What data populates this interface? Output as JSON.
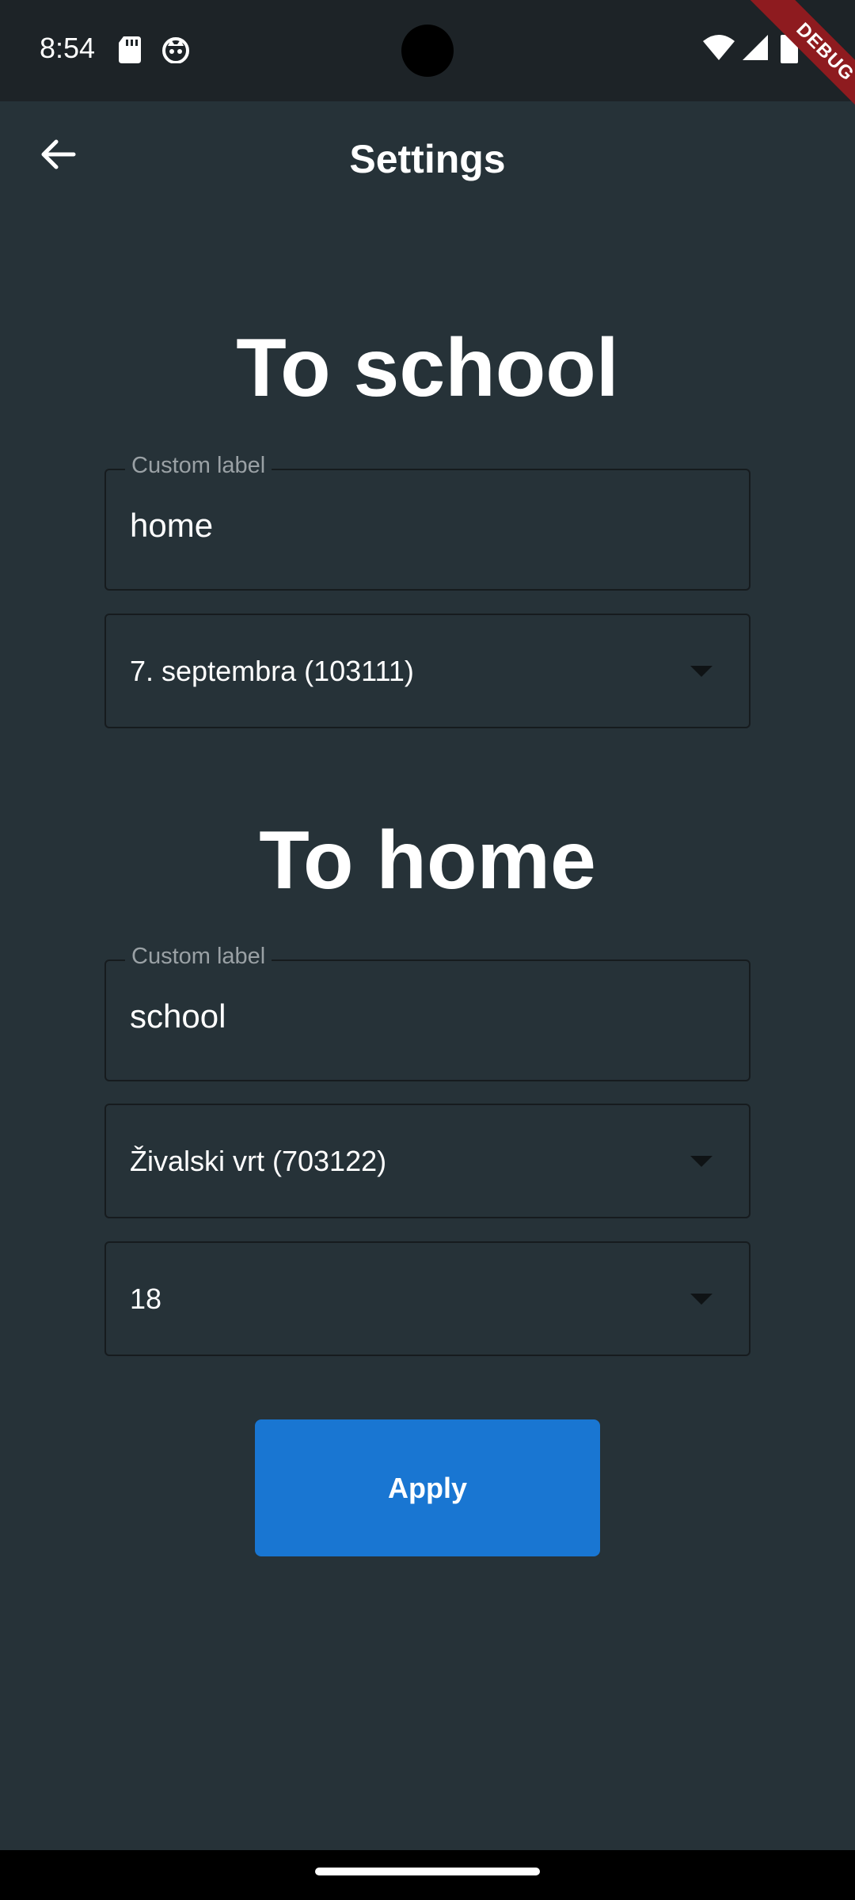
{
  "status_bar": {
    "time": "8:54",
    "icons": [
      "sd-card-icon",
      "cat-icon",
      "wifi-icon",
      "signal-icon",
      "battery-icon"
    ]
  },
  "debug_banner": {
    "label": "DEBUG"
  },
  "app_bar": {
    "title": "Settings",
    "back_icon": "arrow-back-icon"
  },
  "to_school": {
    "title": "To school",
    "custom_label": {
      "label": "Custom label",
      "value": "home"
    },
    "station": {
      "value": "7. septembra (103111)"
    }
  },
  "to_home": {
    "title": "To home",
    "custom_label": {
      "label": "Custom label",
      "value": "school"
    },
    "station": {
      "value": "Živalski vrt (703122)"
    },
    "line": {
      "value": "18"
    }
  },
  "apply_button": {
    "label": "Apply"
  },
  "colors": {
    "background": "#263238",
    "accent": "#1976d2",
    "debug_ribbon": "#8e1b1f"
  }
}
